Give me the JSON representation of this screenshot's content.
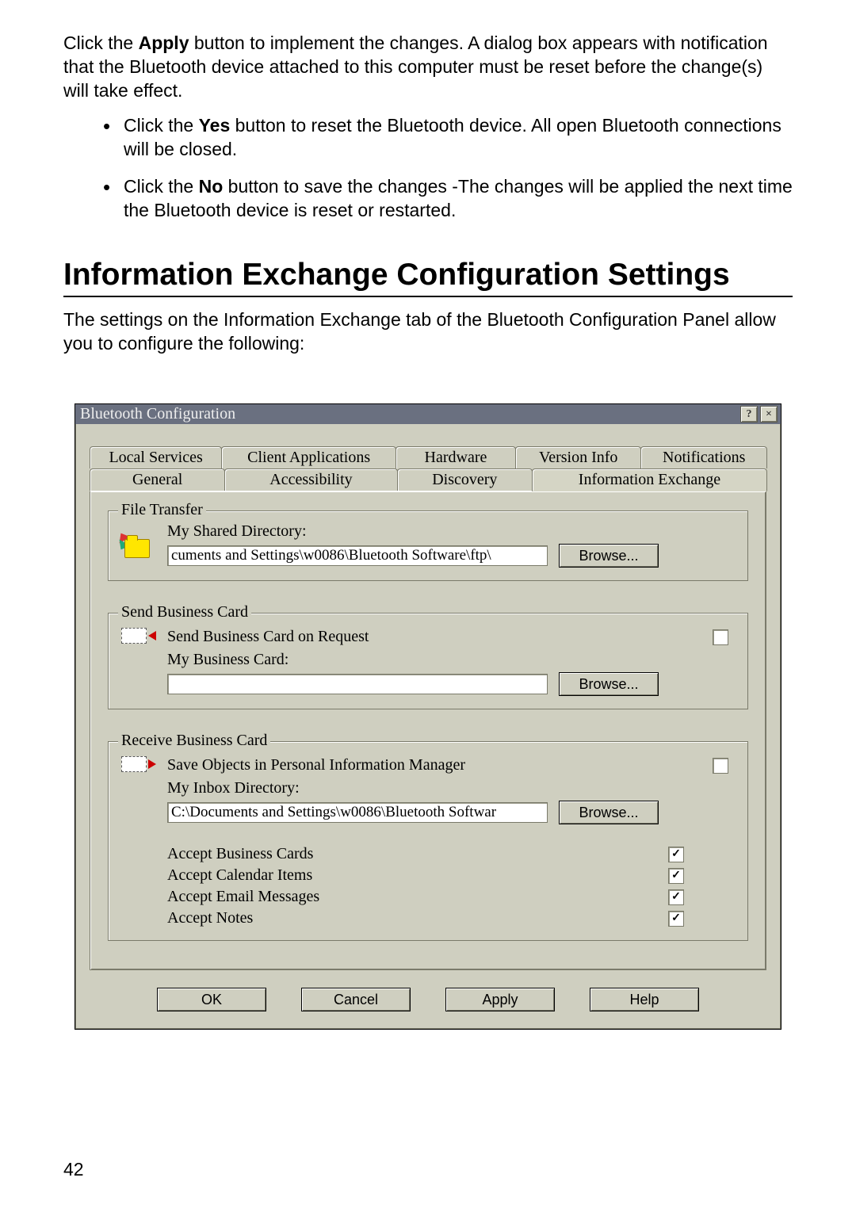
{
  "doc": {
    "p1_pre": "Click the ",
    "p1_bold": "Apply",
    "p1_post": " button to implement the changes. A dialog box appears with notification that the Bluetooth device attached to this computer must be reset before the change(s) will take effect.",
    "b1_pre": "Click the ",
    "b1_bold": "Yes",
    "b1_post": " button to reset the Bluetooth device. All open Bluetooth connections will be closed.",
    "b2_pre": "Click the ",
    "b2_bold": "No",
    "b2_post": " button to save the changes -The changes will be applied the next time the Bluetooth device is reset or restarted.",
    "heading": "Information Exchange Configuration Settings",
    "p2": "The settings on the Information Exchange tab of the Bluetooth Configuration Panel allow you to configure the following:",
    "page_number": "42"
  },
  "dialog": {
    "title": "Bluetooth Configuration",
    "help_btn": "?",
    "close_btn": "×",
    "tabs_row1": [
      "Local Services",
      "Client Applications",
      "Hardware",
      "Version Info",
      "Notifications"
    ],
    "tabs_row2": [
      "General",
      "Accessibility",
      "Discovery",
      "Information Exchange"
    ],
    "selected_tab": "Information Exchange",
    "file_transfer": {
      "legend": "File Transfer",
      "label": "My Shared Directory:",
      "path": "cuments and Settings\\w0086\\Bluetooth Software\\ftp\\",
      "browse": "Browse..."
    },
    "send_card": {
      "legend": "Send Business Card",
      "req_label": "Send Business Card on Request",
      "req_checked": false,
      "label": "My Business Card:",
      "path": "",
      "browse": "Browse..."
    },
    "recv_card": {
      "legend": "Receive Business Card",
      "pim_label": "Save Objects in Personal Information Manager",
      "pim_checked": false,
      "inbox_label": "My Inbox Directory:",
      "inbox_path": "C:\\Documents and Settings\\w0086\\Bluetooth Softwar",
      "browse": "Browse...",
      "accepts": [
        {
          "label": "Accept Business Cards",
          "checked": true
        },
        {
          "label": "Accept Calendar Items",
          "checked": true
        },
        {
          "label": "Accept Email Messages",
          "checked": true
        },
        {
          "label": "Accept Notes",
          "checked": true
        }
      ]
    },
    "buttons": {
      "ok": "OK",
      "cancel": "Cancel",
      "apply": "Apply",
      "help": "Help"
    }
  }
}
